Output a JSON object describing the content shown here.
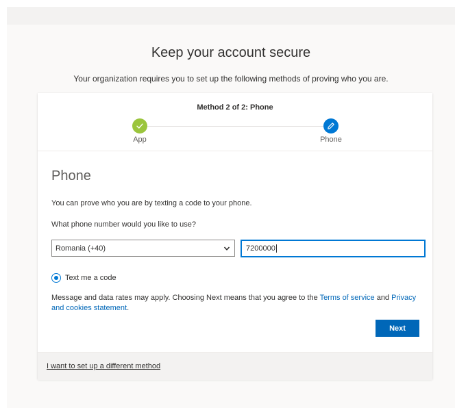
{
  "header": {
    "title": "Keep your account secure",
    "subtitle": "Your organization requires you to set up the following methods of proving who you are."
  },
  "progress": {
    "method_title": "Method 2 of 2: Phone",
    "steps": [
      {
        "label": "App",
        "status": "complete",
        "icon": "checkmark-icon"
      },
      {
        "label": "Phone",
        "status": "current",
        "icon": "pencil-icon"
      }
    ]
  },
  "phone_section": {
    "title": "Phone",
    "description": "You can prove who you are by texting a code to your phone.",
    "question": "What phone number would you like to use?",
    "country_select": "Romania (+40)",
    "phone_value": "7200000",
    "radio_label": "Text me a code",
    "disclaimer_prefix": "Message and data rates may apply. Choosing Next means that you agree to the ",
    "terms_link": "Terms of service",
    "disclaimer_and": " and ",
    "privacy_link": "Privacy and cookies statement",
    "disclaimer_suffix": ".",
    "next_label": "Next"
  },
  "footer": {
    "different_method_link": "I want to set up a different method"
  },
  "colors": {
    "accent": "#0078d4",
    "success": "#9bc53d",
    "link": "#0067b8"
  }
}
